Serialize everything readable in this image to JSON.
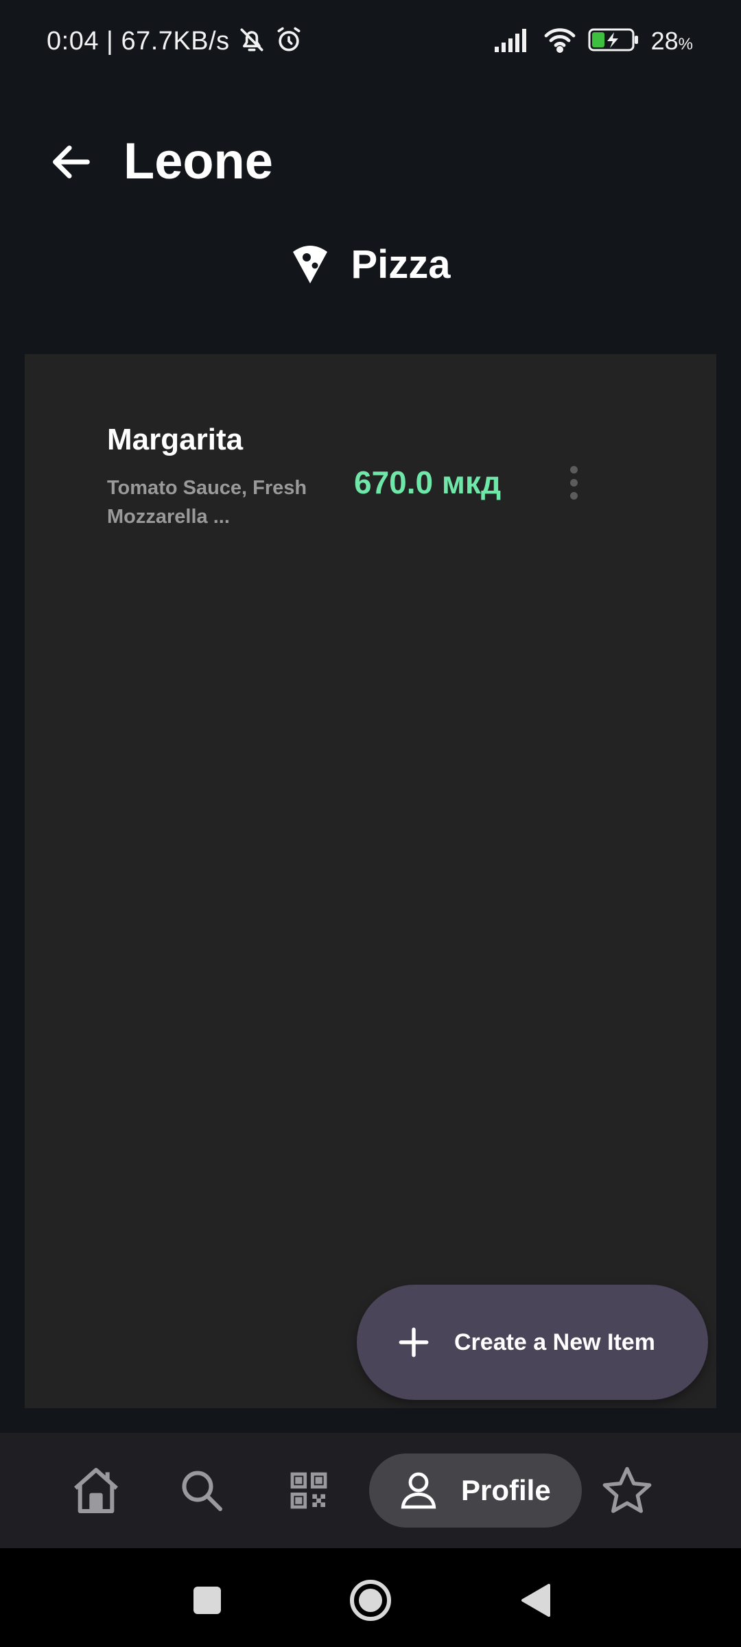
{
  "status_bar": {
    "time_and_speed": "0:04 | 67.7KB/s",
    "battery_value": "28",
    "battery_unit": "%",
    "icons": [
      "mute-icon",
      "alarm-icon",
      "signal-icon",
      "wifi-icon",
      "battery-charging-icon"
    ]
  },
  "header": {
    "title": "Leone",
    "back_icon": "arrow-left-icon"
  },
  "category": {
    "title": "Pizza",
    "icon": "pizza-slice-icon"
  },
  "items": [
    {
      "name": "Margarita",
      "description": "Tomato Sauce, Fresh Mozzarella ...",
      "price": "670.0 мкд",
      "menu_icon": "more-vert-icon"
    }
  ],
  "fab": {
    "label": "Create a New Item",
    "icon": "plus-icon"
  },
  "bottom_nav": {
    "items": [
      {
        "name": "home",
        "icon": "home-icon"
      },
      {
        "name": "search",
        "icon": "search-icon"
      },
      {
        "name": "qr",
        "icon": "qr-code-icon"
      },
      {
        "name": "profile",
        "icon": "person-icon",
        "label": "Profile",
        "selected": true
      },
      {
        "name": "favorites",
        "icon": "star-icon"
      }
    ]
  },
  "colors": {
    "background": "#12151a",
    "panel": "#232323",
    "price": "#6ee7a8",
    "fab": "#4b4559",
    "nav_bar": "#1f1f23",
    "nav_selected": "#444449"
  }
}
